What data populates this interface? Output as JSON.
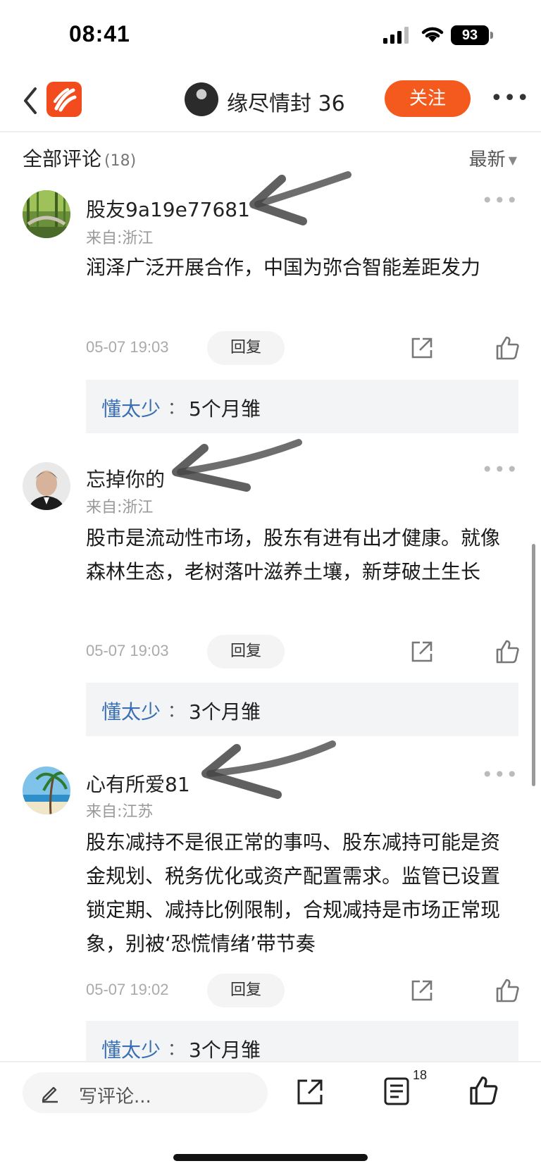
{
  "status_bar": {
    "time": "08:41",
    "battery": "93"
  },
  "header": {
    "author_name": "缘尽情封 36",
    "follow_label": "关注",
    "more": "•••"
  },
  "comments_header": {
    "title": "全部评论",
    "count": "(18)",
    "sort_label": "最新"
  },
  "comments": [
    {
      "username": "股友9a19e77681",
      "location": "来自:浙江",
      "text": "润泽广泛开展合作，中国为弥合智能差距发力",
      "time": "05-07 19:03",
      "reply_label": "回复",
      "sub_reply": {
        "user": "懂太少",
        "sep": "：",
        "text": "5个月雏"
      }
    },
    {
      "username": "忘掉你的",
      "location": "来自:浙江",
      "text": "股市是流动性市场，股东有进有出才健康。就像森林生态，老树落叶滋养土壤，新芽破土生长",
      "time": "05-07 19:03",
      "reply_label": "回复",
      "sub_reply": {
        "user": "懂太少",
        "sep": "：",
        "text": "3个月雏"
      }
    },
    {
      "username": "心有所爱81",
      "location": "来自:江苏",
      "text": "股东减持不是很正常的事吗、股东减持可能是资金规划、税务优化或资产配置需求。监管已设置锁定期、减持比例限制，合规减持是市场正常现象，别被‘恐慌情绪’带节奏",
      "time": "05-07 19:02",
      "reply_label": "回复",
      "sub_reply": {
        "user": "懂太少",
        "sep": "：",
        "text": "3个月雏"
      }
    }
  ],
  "bottom_bar": {
    "write_placeholder": "写评论...",
    "comment_count_badge": "18"
  },
  "colors": {
    "accent": "#f4591d",
    "link_blue": "#3b6fb3",
    "sub_bg": "#f3f4f6"
  }
}
